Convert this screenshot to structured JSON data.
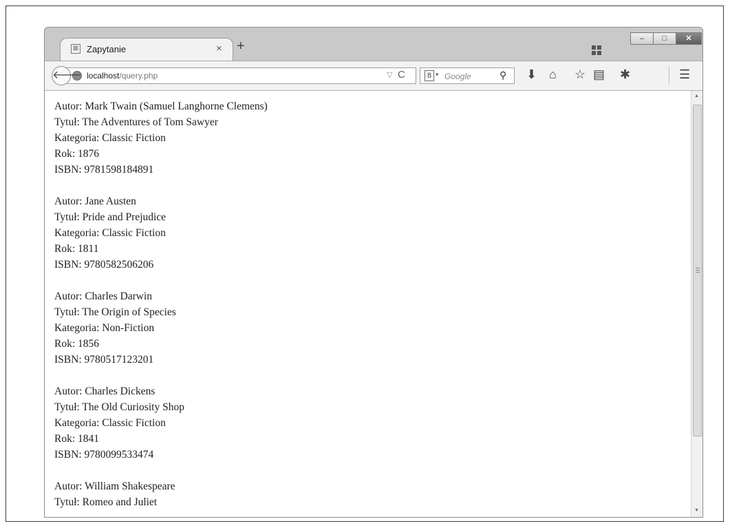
{
  "window": {
    "tab_title": "Zapytanie",
    "tab_close": "×",
    "new_tab": "+",
    "controls": {
      "minimize": "‒",
      "maximize": "□",
      "close": "✕"
    }
  },
  "navbar": {
    "back": "🡐",
    "url_host": "localhost",
    "url_path": "/query.php",
    "url_dropdown": "▽",
    "reload": "C",
    "search_engine_icon": "8",
    "search_placeholder": "Google",
    "search_icon": "⚲",
    "icons": [
      "back-arrow-icon",
      "globe-icon",
      "reload-icon",
      "google-icon",
      "search-icon",
      "download-icon",
      "home-icon",
      "bookmark-star-icon",
      "reading-list-icon",
      "addon-icon",
      "menu-icon"
    ],
    "download": "⬇",
    "home": "⌂",
    "bookmark": "☆",
    "reading_list": "▤",
    "addon": "✱",
    "menu": "☰"
  },
  "books": [
    {
      "author": "Autor: Mark Twain (Samuel Langhorne Clemens)",
      "title": "Tytuł: The Adventures of Tom Sawyer",
      "category": "Kategoria: Classic Fiction",
      "year": "Rok: 1876",
      "isbn": "ISBN: 9781598184891"
    },
    {
      "author": "Autor: Jane Austen",
      "title": "Tytuł: Pride and Prejudice",
      "category": "Kategoria: Classic Fiction",
      "year": "Rok: 1811",
      "isbn": "ISBN: 9780582506206"
    },
    {
      "author": "Autor: Charles Darwin",
      "title": "Tytuł: The Origin of Species",
      "category": "Kategoria: Non-Fiction",
      "year": "Rok: 1856",
      "isbn": "ISBN: 9780517123201"
    },
    {
      "author": "Autor: Charles Dickens",
      "title": "Tytuł: The Old Curiosity Shop",
      "category": "Kategoria: Classic Fiction",
      "year": "Rok: 1841",
      "isbn": "ISBN: 9780099533474"
    },
    {
      "author": "Autor: William Shakespeare",
      "title": "Tytuł: Romeo and Juliet"
    }
  ],
  "scrollbar": {
    "up": "▲",
    "down": "▼"
  }
}
